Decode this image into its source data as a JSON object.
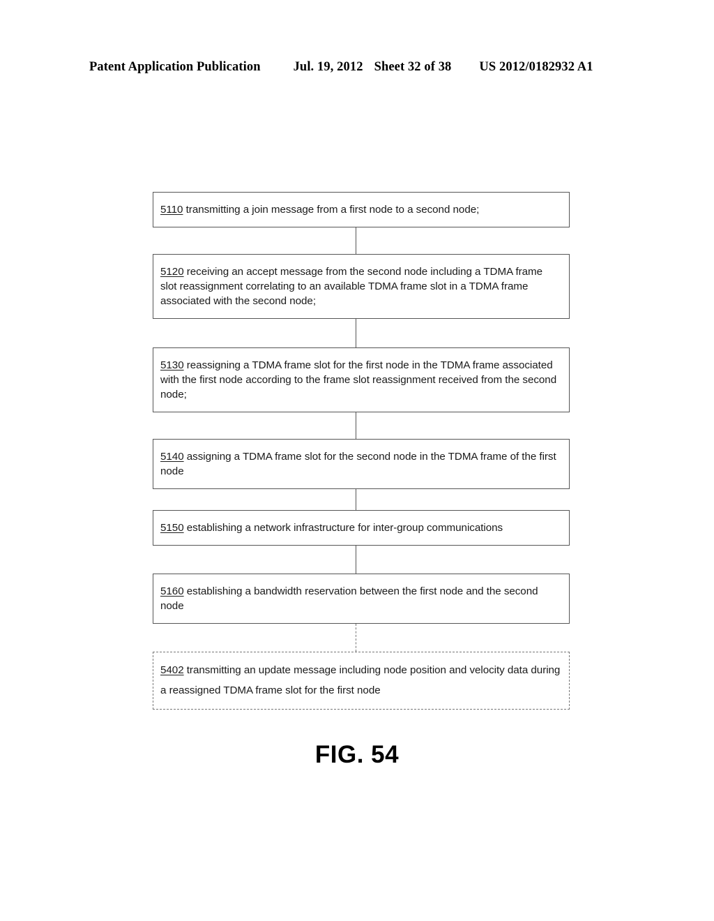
{
  "header": {
    "publication": "Patent Application Publication",
    "date": "Jul. 19, 2012",
    "sheet": "Sheet 32 of 38",
    "document_number": "US 2012/0182932 A1"
  },
  "figure": {
    "caption": "FIG. 54",
    "type": "flowchart",
    "orientation": "vertical",
    "connector_style": "solid-vertical-line",
    "steps": [
      {
        "ref": "5110",
        "text": " transmitting a join message from a first node to a second node;",
        "border": "solid",
        "optional": false
      },
      {
        "ref": "5120",
        "text": " receiving an accept message from the second node including a TDMA frame slot reassignment correlating to an available TDMA frame slot in a TDMA frame associated with the second node;",
        "border": "solid",
        "optional": false
      },
      {
        "ref": "5130",
        "text": " reassigning a TDMA frame slot for the first node in the TDMA frame associated with the first node according to the frame slot reassignment received from the second node;",
        "border": "solid",
        "optional": false
      },
      {
        "ref": "5140",
        "text": " assigning a TDMA frame slot for the second node in the TDMA frame of the first node",
        "border": "solid",
        "optional": false
      },
      {
        "ref": "5150",
        "text": " establishing a network infrastructure for inter-group communications",
        "border": "solid",
        "optional": false
      },
      {
        "ref": "5160",
        "text": " establishing a bandwidth reservation between the first node and the second node",
        "border": "solid",
        "optional": false
      },
      {
        "ref": "5402",
        "text": " transmitting an update message including node position and velocity data during a reassigned TDMA frame slot for the first node",
        "border": "dashed",
        "optional": true
      }
    ]
  }
}
